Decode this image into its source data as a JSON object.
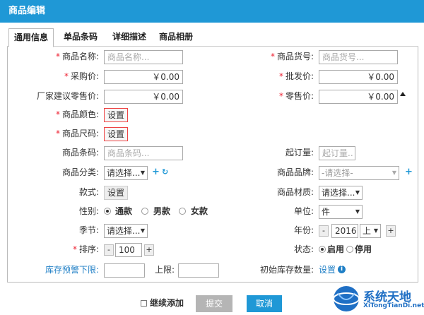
{
  "window": {
    "title": "商品编辑"
  },
  "tabs": [
    "通用信息",
    "单品条码",
    "详细描述",
    "商品相册"
  ],
  "fields": {
    "name_label": "商品名称:",
    "name_placeholder": "商品名称...",
    "sku_label": "商品货号:",
    "sku_placeholder": "商品货号...",
    "purchase_label": "采购价:",
    "purchase_value": "￥0.00",
    "wholesale_label": "批发价:",
    "wholesale_value": "￥0.00",
    "msrp_label": "厂家建议零售价:",
    "msrp_value": "￥0.00",
    "retail_label": "零售价:",
    "retail_value": "￥0.00",
    "color_label": "商品颜色:",
    "size_label": "商品尺码:",
    "barcode_label": "商品条码:",
    "barcode_placeholder": "商品条码...",
    "min_order_label": "起订量:",
    "min_order_placeholder": "起订量..",
    "category_label": "商品分类:",
    "category_value": "请选择...",
    "brand_label": "商品品牌:",
    "brand_value": "-请选择-",
    "style_label": "款式:",
    "material_label": "商品材质:",
    "material_value": "请选择...",
    "gender_label": "性别:",
    "gender_options": [
      "通款",
      "男款",
      "女款"
    ],
    "unit_label": "单位:",
    "unit_value": "件",
    "season_label": "季节:",
    "season_value": "请选择...",
    "year_label": "年份:",
    "year_value": "2016",
    "year_half": "上",
    "sort_label": "排序:",
    "sort_value": "100",
    "status_label": "状态:",
    "status_options": [
      "启用",
      "停用"
    ],
    "stock_warn_label": "库存预警下限:",
    "stock_upper_label": "上限:",
    "init_stock_label": "初始库存数量:",
    "set_label": "设置",
    "minus": "-",
    "plus": "+"
  },
  "footer": {
    "continue_label": "继续添加",
    "submit_label": "提交",
    "cancel_label": "取消"
  },
  "watermark": {
    "name": "系统天地",
    "url": "XiTongTianDi.net"
  },
  "colors": {
    "accent": "#1f98d6",
    "required": "#e23333"
  }
}
